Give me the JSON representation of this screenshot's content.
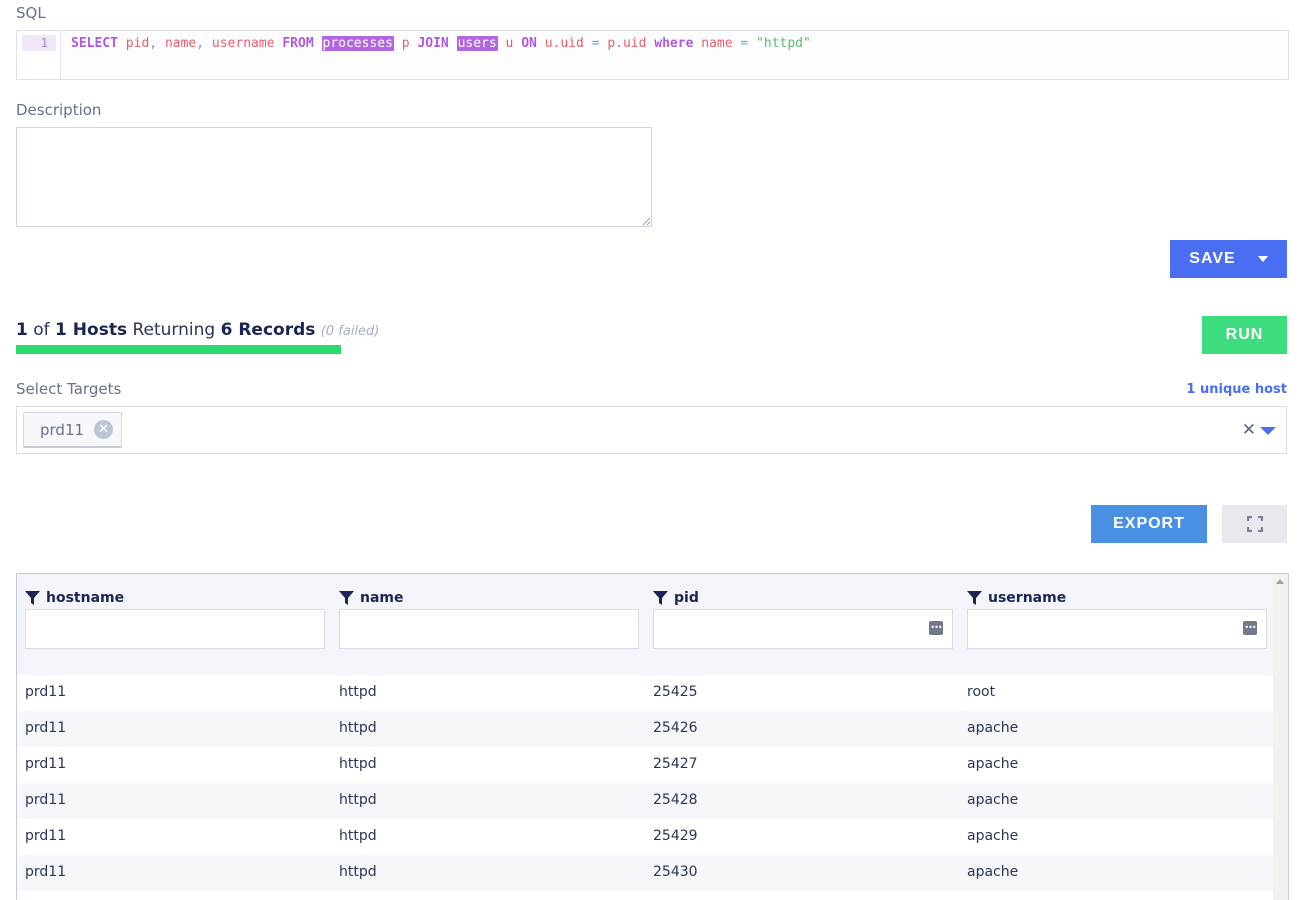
{
  "sql": {
    "label": "SQL",
    "line_number": "1",
    "tokens": {
      "select": "SELECT",
      "pid": "pid",
      "comma1": ",",
      "name": "name",
      "comma2": ",",
      "username": "username",
      "from": "FROM",
      "processes": "processes",
      "p": "p",
      "join": "JOIN",
      "users": "users",
      "u": "u",
      "on": "ON",
      "u_uid": "u.uid",
      "eq": "=",
      "p_uid": "p.uid",
      "where": "where",
      "name2": "name",
      "eq2": "=",
      "value": "\"httpd\""
    }
  },
  "description": {
    "label": "Description",
    "value": ""
  },
  "save": {
    "label": "SAVE"
  },
  "status": {
    "count": "1",
    "of": "of",
    "total_hosts": "1 Hosts",
    "returning": "Returning",
    "records": "6 Records",
    "failed": "(0 failed)",
    "progress_fraction": 1.0
  },
  "run": {
    "label": "RUN"
  },
  "targets": {
    "label": "Select Targets",
    "unique": "1 unique host",
    "selected": [
      "prd11"
    ]
  },
  "export": {
    "label": "EXPORT"
  },
  "table": {
    "columns": [
      "hostname",
      "name",
      "pid",
      "username"
    ],
    "rows": [
      [
        "prd11",
        "httpd",
        "25425",
        "root"
      ],
      [
        "prd11",
        "httpd",
        "25426",
        "apache"
      ],
      [
        "prd11",
        "httpd",
        "25427",
        "apache"
      ],
      [
        "prd11",
        "httpd",
        "25428",
        "apache"
      ],
      [
        "prd11",
        "httpd",
        "25429",
        "apache"
      ],
      [
        "prd11",
        "httpd",
        "25430",
        "apache"
      ]
    ]
  },
  "colors": {
    "primary": "#4a6ef1",
    "run": "#3ddc7e",
    "export": "#4a90e2",
    "progress": "#2ada6c"
  }
}
